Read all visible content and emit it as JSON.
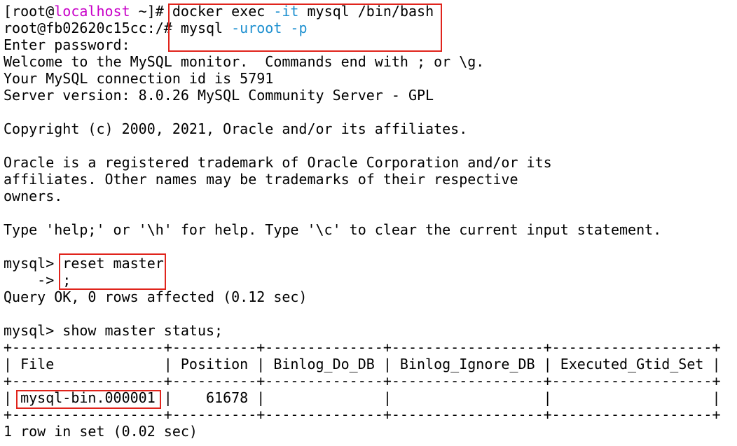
{
  "terminal": {
    "line1": {
      "prompt_open": "[root@",
      "host": "localhost",
      "prompt_rest": " ~]# ",
      "cmd_a": "docker exec ",
      "flag": "-it",
      "cmd_b": " mysql /bin/bash"
    },
    "line2": {
      "prompt": "root@fb02620c15cc:/# ",
      "cmd": "mysql ",
      "flag_a": "-uroot",
      "space": " ",
      "flag_b": "-p"
    },
    "line3": "Enter password:",
    "line4": "Welcome to the MySQL monitor.  Commands end with ; or \\g.",
    "line5": "Your MySQL connection id is 5791",
    "line6": "Server version: 8.0.26 MySQL Community Server - GPL",
    "line8": "Copyright (c) 2000, 2021, Oracle and/or its affiliates.",
    "line10": "Oracle is a registered trademark of Oracle Corporation and/or its",
    "line11": "affiliates. Other names may be trademarks of their respective",
    "line12": "owners.",
    "line14": "Type 'help;' or '\\h' for help. Type '\\c' to clear the current input statement.",
    "line16": {
      "prompt": "mysql> ",
      "cmd": "reset master"
    },
    "line17": {
      "prompt": "    -> ",
      "cmd": ";"
    },
    "line18": "Query OK, 0 rows affected (0.12 sec)",
    "line20": {
      "prompt": "mysql> ",
      "cmd": "show master status;"
    },
    "table_border": "+------------------+----------+--------------+------------------+-------------------+",
    "table_header": "| File             | Position | Binlog_Do_DB | Binlog_Ignore_DB | Executed_Gtid_Set |",
    "table_row": {
      "lead": "| ",
      "file": "mysql-bin.000001",
      "rest": " |    61678 |              |                  |                   |"
    },
    "line26": "1 row in set (0.02 sec)"
  },
  "colors": {
    "background": "#ffffff",
    "text": "#000000",
    "hostname": "#c800c8",
    "flags": "#1e90d0",
    "highlight_box": "#e0241c"
  }
}
